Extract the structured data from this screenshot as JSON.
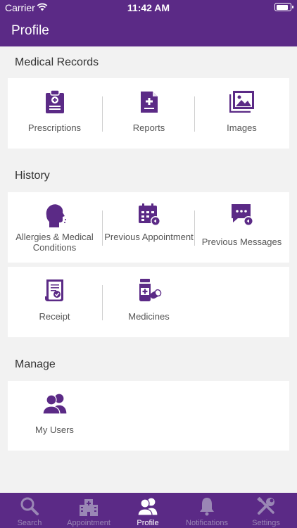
{
  "status_bar": {
    "carrier": "Carrier",
    "time": "11:42 AM"
  },
  "header": {
    "title": "Profile"
  },
  "sections": {
    "medical_records": {
      "title": "Medical Records",
      "items": [
        {
          "label": "Prescriptions",
          "icon": "prescription-clipboard-icon"
        },
        {
          "label": "Reports",
          "icon": "report-document-icon"
        },
        {
          "label": "Images",
          "icon": "images-gallery-icon"
        }
      ]
    },
    "history": {
      "title": "History",
      "row1": [
        {
          "label": "Allergies & Medical Conditions",
          "icon": "head-profile-icon"
        },
        {
          "label": "Previous Appointment",
          "icon": "calendar-history-icon"
        },
        {
          "label": "Previous Messages",
          "icon": "message-history-icon"
        }
      ],
      "row2": [
        {
          "label": "Receipt",
          "icon": "receipt-icon"
        },
        {
          "label": "Medicines",
          "icon": "medicine-bottle-pills-icon"
        }
      ]
    },
    "manage": {
      "title": "Manage",
      "items": [
        {
          "label": "My Users",
          "icon": "users-icon"
        }
      ]
    }
  },
  "tabbar": [
    {
      "label": "Search",
      "icon": "search-icon",
      "active": false
    },
    {
      "label": "Appointment",
      "icon": "hospital-icon",
      "active": false
    },
    {
      "label": "Profile",
      "icon": "profile-users-icon",
      "active": true
    },
    {
      "label": "Notifications",
      "icon": "bell-icon",
      "active": false
    },
    {
      "label": "Settings",
      "icon": "tools-icon",
      "active": false
    }
  ],
  "colors": {
    "brand": "#5b2a86",
    "background": "#f2f2f2",
    "card": "#ffffff",
    "tab_inactive": "#9a87b5"
  }
}
